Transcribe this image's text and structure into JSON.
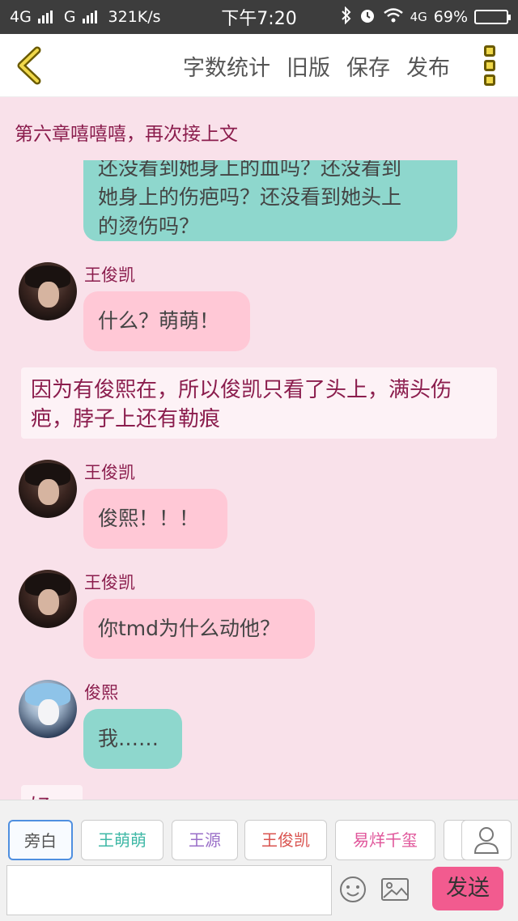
{
  "status_bar": {
    "left_text": "4G",
    "g_text": "G",
    "speed": "321K/s",
    "time": "下午7:20",
    "network_right": "4G",
    "battery": "69%",
    "battery_level": 0.69
  },
  "header": {
    "menu": [
      "字数统计",
      "旧版",
      "保存",
      "发布"
    ]
  },
  "chapter_title": "第六章嘻嘻嘻，再次接上文",
  "messages": [
    {
      "type": "bubble",
      "style": "teal",
      "lines": [
        "还没看到她身上的血吗？还没看到",
        "她身上的伤疤吗？还没看到她头上",
        "的烫伤吗？"
      ]
    },
    {
      "type": "bubble",
      "speaker": "王俊凯",
      "style": "pink",
      "text": "什么？萌萌！"
    },
    {
      "type": "narration",
      "lines": [
        "因为有俊熙在，所以俊凯只看了头上，满头伤",
        "疤，脖子上还有勒痕"
      ]
    },
    {
      "type": "bubble",
      "speaker": "王俊凯",
      "style": "pink",
      "text": "俊熙！！！"
    },
    {
      "type": "bubble",
      "speaker": "王俊凯",
      "style": "pink",
      "text": "你tmd为什么动他？"
    },
    {
      "type": "bubble",
      "speaker": "俊熙",
      "style": "teal",
      "text": "我……"
    },
    {
      "type": "narration_partial",
      "text": "好 可"
    }
  ],
  "characters": [
    {
      "name": "旁白",
      "color": "#666666"
    },
    {
      "name": "王萌萌",
      "color": "#3fb8a6"
    },
    {
      "name": "王源",
      "color": "#9a6fc8"
    },
    {
      "name": "王俊凯",
      "color": "#d9534f"
    },
    {
      "name": "易烊千玺",
      "color": "#e0559a"
    }
  ],
  "input": {
    "value": "",
    "send_label": "发送"
  },
  "colors": {
    "accent": "#f25b8f",
    "teal_bubble": "#8ed7cd",
    "pink_bubble": "#ffc8d6",
    "background": "#f9e1ea",
    "chapter_text": "#8b1d4d"
  }
}
